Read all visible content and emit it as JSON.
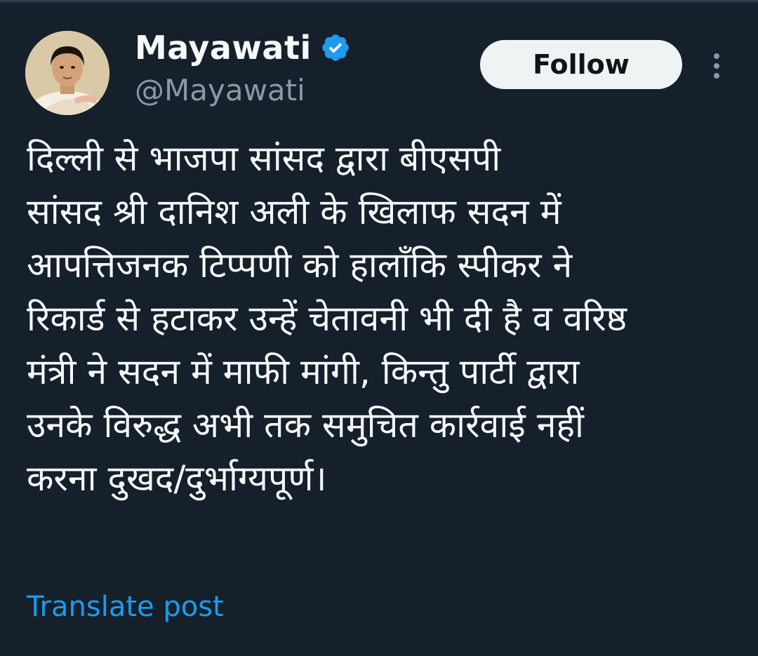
{
  "user": {
    "display_name": "Mayawati",
    "handle": "@Mayawati",
    "verified": true,
    "verified_color": "#1d9bf0"
  },
  "actions": {
    "follow_label": "Follow"
  },
  "tweet": {
    "lines": [
      "दिल्ली से भाजपा सांसद द्वारा बीएसपी",
      "सांसद श्री दानिश अली के खिलाफ सदन में",
      "आपत्तिजनक टिप्पणी को हालाँकि स्पीकर ने",
      "रिकार्ड से हटाकर उन्हें चेतावनी भी दी है व वरिष्ठ",
      "मंत्री ने सदन में माफी मांगी, किन्तु पार्टी द्वारा",
      "उनके विरुद्ध अभी तक समुचित कार्रवाई नहीं",
      "करना दुखद/दुर्भाग्यपूर्ण।"
    ],
    "translate_label": "Translate post"
  },
  "theme": {
    "background": "#15202b",
    "text_primary": "#f7f9f9",
    "text_secondary": "#8b98a5",
    "link": "#1d9bf0"
  }
}
